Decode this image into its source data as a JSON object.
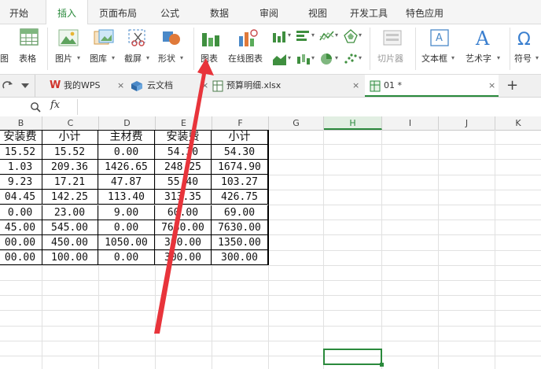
{
  "menu_tabs": [
    {
      "label": "开始"
    },
    {
      "label": "插入"
    },
    {
      "label": "页面布局"
    },
    {
      "label": "公式"
    },
    {
      "label": "数据"
    },
    {
      "label": "审阅"
    },
    {
      "label": "视图"
    },
    {
      "label": "开发工具"
    },
    {
      "label": "特色应用"
    }
  ],
  "active_tab": "插入",
  "ribbon": {
    "pivot_label": "图",
    "table_label": "表格",
    "picture_label": "图片",
    "gallery_label": "图库",
    "screenshot_label": "截屏",
    "shapes_label": "形状",
    "chart_label": "图表",
    "online_chart_label": "在线图表",
    "slicer_label": "切片器",
    "textbox_label": "文本框",
    "wordart_label": "艺术字",
    "symbol_label": "符号",
    "dropdown_glyph": "▾"
  },
  "doc_tabs": {
    "mywps": "我的WPS",
    "cloud": "云文档",
    "file1": "预算明细.xlsx",
    "file2": "01 *",
    "close_glyph": "×",
    "add_glyph": "+"
  },
  "formula_bar": {
    "fx_label": "fx"
  },
  "columns": [
    "B",
    "C",
    "D",
    "E",
    "F",
    "G",
    "H",
    "I",
    "J",
    "K"
  ],
  "selected_column": "H",
  "table": {
    "headers": [
      "安装费",
      "小计",
      "主材费",
      "安装费",
      "小计"
    ],
    "rows": [
      [
        "15.52",
        "15.52",
        "0.00",
        "54.30",
        "54.30"
      ],
      [
        "1.03",
        "209.36",
        "1426.65",
        "248.25",
        "1674.90"
      ],
      [
        "9.23",
        "17.21",
        "47.87",
        "55.40",
        "103.27"
      ],
      [
        "04.45",
        "142.25",
        "113.40",
        "313.35",
        "426.75"
      ],
      [
        "0.00",
        "23.00",
        "9.00",
        "60.00",
        "69.00"
      ],
      [
        "45.00",
        "545.00",
        "0.00",
        "7630.00",
        "7630.00"
      ],
      [
        "00.00",
        "450.00",
        "1050.00",
        "300.00",
        "1350.00"
      ],
      [
        "00.00",
        "100.00",
        "0.00",
        "300.00",
        "300.00"
      ]
    ]
  },
  "colors": {
    "accent": "#2a8a3c",
    "arrow": "#e8343b"
  }
}
